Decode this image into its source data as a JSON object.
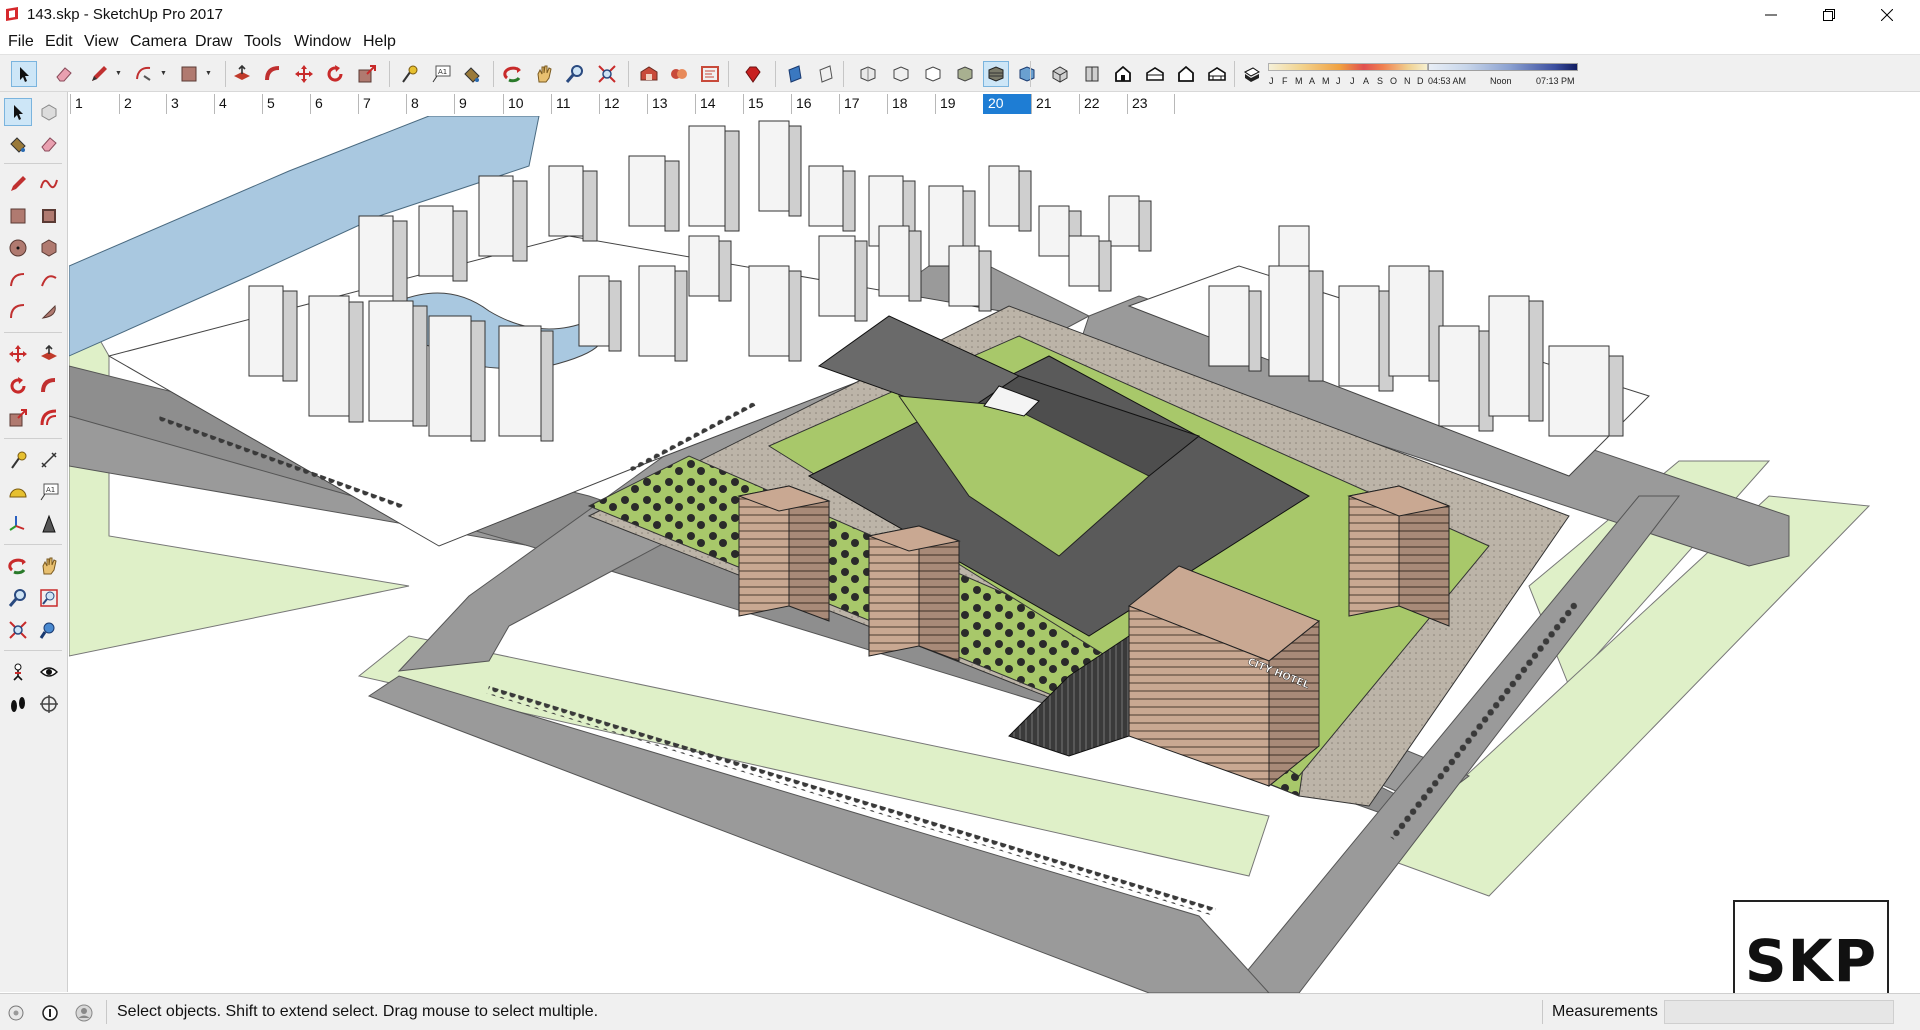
{
  "window": {
    "title": "143.skp - SketchUp Pro 2017"
  },
  "menu": {
    "items": [
      "File",
      "Edit",
      "View",
      "Camera",
      "Draw",
      "Tools",
      "Window",
      "Help"
    ]
  },
  "toolbar": {
    "tools": [
      "select-icon",
      "eraser-icon",
      "pencil-icon",
      "arc-icon",
      "paint-bucket-icon",
      "push-pull-icon",
      "follow-me-icon",
      "move-icon",
      "rotate-icon",
      "scale-icon",
      "tape-measure-icon",
      "text-icon",
      "paint-icon",
      "orbit-icon",
      "pan-icon",
      "zoom-icon",
      "zoom-extents-icon",
      "warehouse-icon",
      "extension-icon",
      "layout-icon",
      "ruby-icon",
      "section-plane-icon",
      "section-fill-icon",
      "xray-icon",
      "wireframe-icon",
      "hidden-line-icon",
      "shaded-icon",
      "textured-icon",
      "monochrome-icon",
      "iso-view-icon",
      "top-view-icon",
      "front-view-icon",
      "right-view-icon",
      "back-view-icon",
      "left-view-icon",
      "shadows-toggle-icon"
    ]
  },
  "shadows": {
    "months": [
      "J",
      "F",
      "M",
      "A",
      "M",
      "J",
      "J",
      "A",
      "S",
      "O",
      "N",
      "D"
    ],
    "time_start": "04:53 AM",
    "time_mid": "Noon",
    "time_end": "07:13 PM"
  },
  "scenes": {
    "tabs": [
      "1",
      "2",
      "3",
      "4",
      "5",
      "6",
      "7",
      "8",
      "9",
      "10",
      "11",
      "12",
      "13",
      "14",
      "15",
      "16",
      "17",
      "18",
      "19",
      "20",
      "21",
      "22",
      "23"
    ],
    "active": "20"
  },
  "viewport": {
    "hotel_sign": "CITY HOTEL"
  },
  "logo": {
    "text": "SKP"
  },
  "status": {
    "message": "Select objects. Shift to extend select. Drag mouse to select multiple.",
    "measurements_label": "Measurements",
    "measurements_value": ""
  },
  "colors": {
    "active_tab": "#1e7dd4",
    "grass": "#a8c86a",
    "road": "#9a9a9a",
    "river": "#a9c8e0",
    "verge": "#dff0c8"
  }
}
